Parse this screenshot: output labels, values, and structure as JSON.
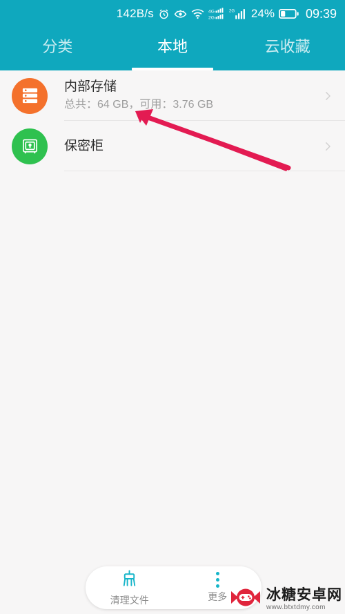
{
  "statusbar": {
    "network_speed": "142B/s",
    "icons": [
      "alarm-clock-icon",
      "eye-protection-icon",
      "wifi-icon",
      "signal-4g-icon",
      "signal-2g-icon"
    ],
    "battery_percent": "24%",
    "time": "09:39"
  },
  "tabs": [
    {
      "label": "分类",
      "active": false
    },
    {
      "label": "本地",
      "active": true
    },
    {
      "label": "云收藏",
      "active": false
    }
  ],
  "list": [
    {
      "title": "内部存储",
      "subtitle": "总共：64 GB，可用：3.76 GB",
      "icon": "internal-storage-icon",
      "icon_color": "#f4712c"
    },
    {
      "title": "保密柜",
      "subtitle": "",
      "icon": "safe-vault-icon",
      "icon_color": "#2fc14f"
    }
  ],
  "bottombar": {
    "items": [
      {
        "label": "清理文件",
        "icon": "broom-icon"
      },
      {
        "label": "更多",
        "icon": "more-vertical-icon"
      }
    ]
  },
  "annotation": {
    "type": "arrow",
    "color": "#e31b52",
    "points_to": "内部存储 storage capacity text"
  },
  "watermark": {
    "name": "冰糖安卓网",
    "url": "www.btxtdmy.com"
  },
  "colors": {
    "accent": "#0fa8be",
    "background": "#f7f6f6",
    "title_text": "#2f2f2f",
    "subtitle_text": "#9d9d9d"
  }
}
